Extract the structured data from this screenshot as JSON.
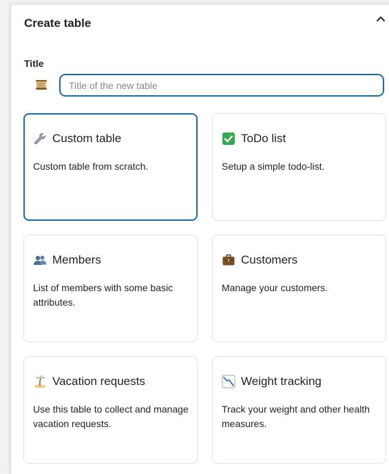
{
  "dialog": {
    "title": "Create table",
    "close_icon": "chevron-up-icon"
  },
  "title_field": {
    "label": "Title",
    "value": "",
    "placeholder": "Title of the new table",
    "emoji_icon": "scroll-icon"
  },
  "templates": [
    {
      "name": "Custom table",
      "description": "Custom table from scratch.",
      "icon": "wrench-icon",
      "selected": true
    },
    {
      "name": "ToDo list",
      "description": "Setup a simple todo-list.",
      "icon": "check-box-icon",
      "selected": false
    },
    {
      "name": "Members",
      "description": "List of members with some basic attributes.",
      "icon": "people-icon",
      "selected": false
    },
    {
      "name": "Customers",
      "description": "Manage your customers.",
      "icon": "briefcase-icon",
      "selected": false
    },
    {
      "name": "Vacation requests",
      "description": "Use this table to collect and manage vacation requests.",
      "icon": "island-icon",
      "selected": false
    },
    {
      "name": "Weight tracking",
      "description": "Track your weight and other health measures.",
      "icon": "chart-decreasing-icon",
      "selected": false
    }
  ],
  "colors": {
    "accent": "#1a6aa5",
    "checkbox_green": "#34a853",
    "card_border": "#e1e1e1",
    "text": "#222222"
  }
}
